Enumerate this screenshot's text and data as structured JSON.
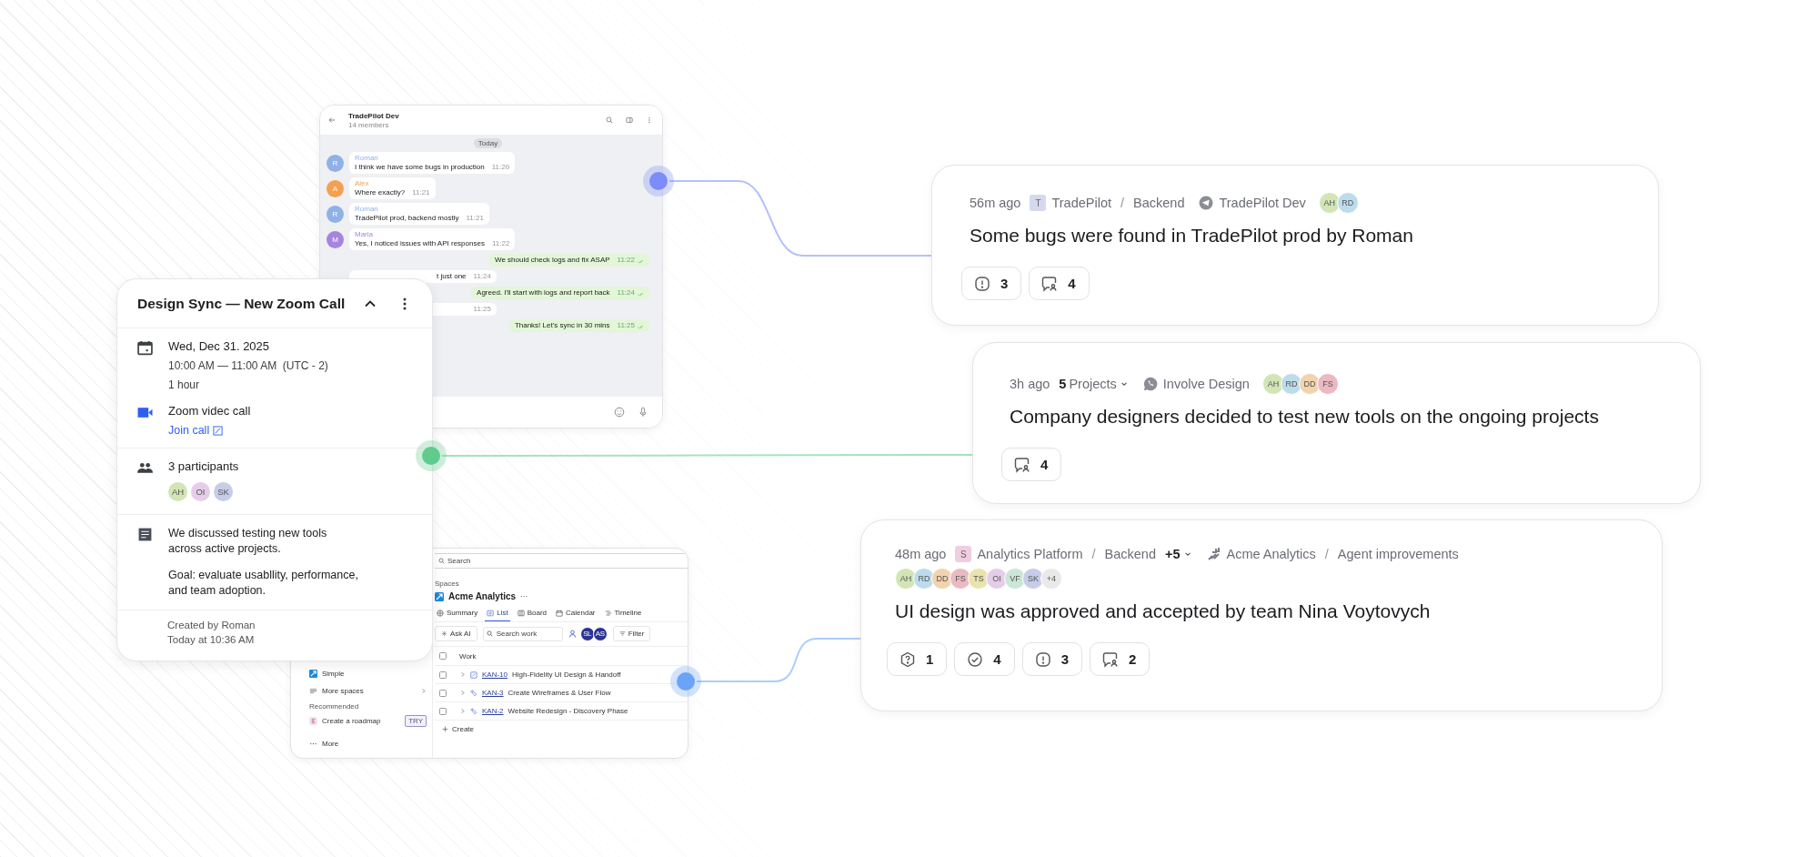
{
  "chat": {
    "title": "TradePilot Dev",
    "subtitle": "14 members",
    "date_chip": "Today",
    "messages": [
      {
        "kind": "in",
        "sender": "Roman",
        "initial": "R",
        "color": "#8fb1e6",
        "text": "I think we have some bugs in production",
        "time": "11:20"
      },
      {
        "kind": "in",
        "sender": "Alex",
        "initial": "A",
        "color": "#f4a052",
        "text": "Where exactly?",
        "time": "11:21"
      },
      {
        "kind": "in",
        "sender": "Roman",
        "initial": "R",
        "color": "#8fb1e6",
        "text": "TradePilot prod, backend mostly",
        "time": "11:21"
      },
      {
        "kind": "in",
        "sender": "Maria",
        "initial": "M",
        "color": "#a685dd",
        "text": "Yes, I noticed issues with API responses",
        "time": "11:22"
      },
      {
        "kind": "out",
        "text": "We should check logs and fix ASAP",
        "time": "11:22"
      },
      {
        "kind": "partial",
        "text": "t just one",
        "time": "11:24"
      },
      {
        "kind": "out",
        "text": "Agreed. I'll start with logs and report back",
        "time": "11:24"
      },
      {
        "kind": "partial",
        "time": "11:25"
      },
      {
        "kind": "out",
        "text": "Thanks! Let's sync in 30 mins",
        "time": "11:25"
      }
    ]
  },
  "calendar": {
    "title": "Design Sync — New Zoom Call",
    "date": "Wed, Dec 31. 2025",
    "time": "10:00 AM — 11:00 AM  (UTC - 2)",
    "duration": "1 hour",
    "call": "Zoom videc call",
    "join_link": "Join call",
    "participants_label": "3 participants",
    "participants": [
      {
        "initials": "AH",
        "color": "#d3e5b5"
      },
      {
        "initials": "OI",
        "color": "#e5cdea"
      },
      {
        "initials": "SK",
        "color": "#c7cde8"
      }
    ],
    "notes": [
      "We discussed testing new tools across active projects.",
      "Goal: evaluate usabllity, performance, and team adoption."
    ],
    "created_by": "Created by Roman",
    "created_at": "Today at 10:36 AM"
  },
  "jira": {
    "search": {
      "placeholder": "Search"
    },
    "sidebar": [
      {
        "kind": "space",
        "label": "Simple"
      },
      {
        "kind": "more",
        "label": "More spaces"
      },
      {
        "kind": "heading",
        "label": "Recommended"
      },
      {
        "kind": "promo",
        "label": "Create a roadmap",
        "badge": "TRY"
      },
      {
        "kind": "dots",
        "label": "More"
      }
    ],
    "breadcrumb": "Spaces",
    "project": "Acme Analytics",
    "project_menu": "···",
    "tabs": [
      {
        "kind": "summary",
        "label": "Summary",
        "selected": false
      },
      {
        "kind": "list",
        "label": "List",
        "selected": true
      },
      {
        "kind": "board",
        "label": "Board",
        "selected": false
      },
      {
        "kind": "calendar",
        "label": "Calendar",
        "selected": false
      },
      {
        "kind": "timeline",
        "label": "Timeline",
        "selected": false
      }
    ],
    "ask_ai": "Ask AI",
    "search_work": {
      "placeholder": "Search work"
    },
    "assignees": [
      "SL",
      "AS"
    ],
    "filter": "Filter",
    "select_all": {
      "checked": false
    },
    "column": "Work",
    "rows": [
      {
        "kind": "task",
        "key": "KAN-10",
        "title": "High-Fidelity UI Design & Handoff",
        "checked": false
      },
      {
        "kind": "feature",
        "key": "KAN-3",
        "title": "Create Wireframes & User Flow",
        "checked": false
      },
      {
        "kind": "feature",
        "key": "KAN-2",
        "title": "Website Redesign - Discovery Phase",
        "checked": false
      }
    ],
    "create": "Create"
  },
  "connectors": [
    {
      "color": "#7c8cf8"
    },
    {
      "color": "#5fcb8c"
    },
    {
      "color": "#6aa3f8"
    }
  ],
  "cards": [
    {
      "time": "56m ago",
      "crumbs": [
        {
          "kind": "project",
          "badge": "T",
          "color": "#d5d9f0",
          "label": "TradePilot"
        },
        {
          "kind": "sep",
          "label": "/"
        },
        {
          "kind": "text",
          "label": "Backend"
        },
        {
          "kind": "telegram",
          "label": "TradePilot Dev"
        }
      ],
      "avatars": [
        {
          "initials": "AH",
          "color": "#d3e5b5"
        },
        {
          "initials": "RD",
          "color": "#bcdcec"
        }
      ],
      "title": "Some bugs were found in TradePilot prod by Roman",
      "stats": [
        {
          "kind": "issue",
          "count": "3"
        },
        {
          "kind": "comment",
          "count": "4"
        }
      ]
    },
    {
      "time": "3h ago",
      "crumbs": [
        {
          "kind": "dropdown",
          "count": "5",
          "label": "Projects"
        },
        {
          "kind": "whatsapp",
          "label": "Involve Design"
        }
      ],
      "avatars": [
        {
          "initials": "AH",
          "color": "#d3e5b5"
        },
        {
          "initials": "RD",
          "color": "#bcdcec"
        },
        {
          "initials": "DD",
          "color": "#f1d3ad"
        },
        {
          "initials": "FS",
          "color": "#eab9c2"
        }
      ],
      "title": "Company designers decided to test new tools on the ongoing projects",
      "stats": [
        {
          "kind": "comment",
          "count": "4"
        }
      ]
    },
    {
      "time": "48m ago",
      "crumbs": [
        {
          "kind": "project",
          "badge": "S",
          "color": "#f0cde0",
          "label": "Analytics Platform"
        },
        {
          "kind": "sep",
          "label": "/"
        },
        {
          "kind": "text",
          "label": "Backend"
        },
        {
          "kind": "dropdown",
          "count": "+5"
        },
        {
          "kind": "acme",
          "label": "Acme Analytics"
        },
        {
          "kind": "sep",
          "label": "/"
        },
        {
          "kind": "text",
          "label": "Agent improvements"
        }
      ],
      "avatars": [
        {
          "initials": "AH",
          "color": "#d3e5b5"
        },
        {
          "initials": "RD",
          "color": "#bcdcec"
        },
        {
          "initials": "DD",
          "color": "#f1d3ad"
        },
        {
          "initials": "FS",
          "color": "#eab9c2"
        },
        {
          "initials": "TS",
          "color": "#e9e4ad"
        },
        {
          "initials": "OI",
          "color": "#e5cdea"
        },
        {
          "initials": "VF",
          "color": "#cbe6d6"
        },
        {
          "initials": "SK",
          "color": "#c7cde8"
        },
        {
          "initials": "+4",
          "color": "#e9e9ea"
        }
      ],
      "wrap_avatars": true,
      "title": "UI design was approved and accepted by team Nina Voytovych",
      "stats": [
        {
          "kind": "question",
          "count": "1"
        },
        {
          "kind": "done",
          "count": "4"
        },
        {
          "kind": "issue",
          "count": "3"
        },
        {
          "kind": "comment",
          "count": "2"
        }
      ]
    }
  ]
}
